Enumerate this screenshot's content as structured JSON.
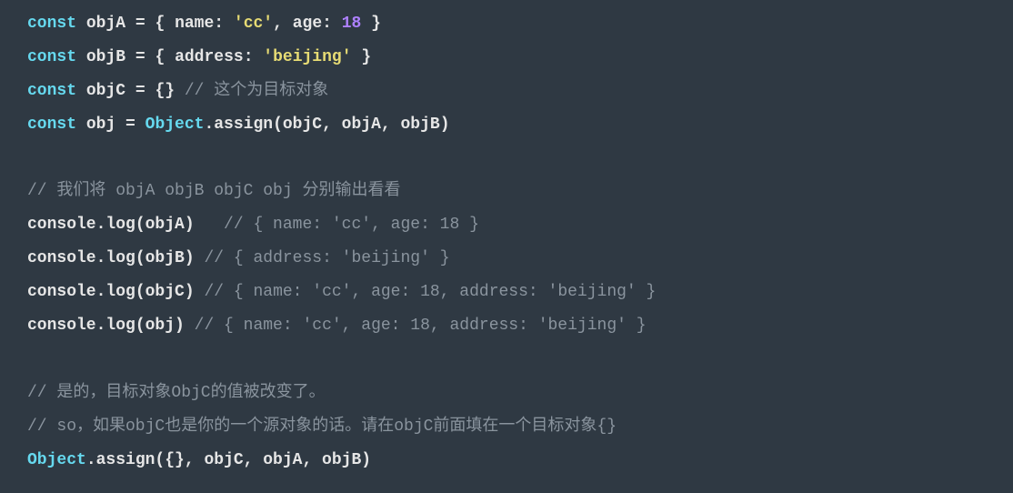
{
  "lines": {
    "l1": {
      "kw": "const",
      "v": "objA",
      "eq": " = { ",
      "p1": "name",
      "s1": "'cc'",
      "c": ", ",
      "p2": "age",
      "n1": "18",
      "end": " }"
    },
    "l2": {
      "kw": "const",
      "v": "objB",
      "eq": " = { ",
      "p1": "address",
      "s1": "'beijing'",
      "end": " }"
    },
    "l3": {
      "kw": "const",
      "v": "objC",
      "eq": " = {} ",
      "cm": "// 这个为目标对象"
    },
    "l4": {
      "kw": "const",
      "v": "obj",
      "eq": " = ",
      "cls": "Object",
      "m": ".assign(",
      "args": "objC, objA, objB)"
    },
    "l6": {
      "cm": "// 我们将 objA objB objC obj 分别输出看看"
    },
    "l7": {
      "call": "console.log(objA)",
      "pad": "   ",
      "cm": "// { name: 'cc', age: 18 }"
    },
    "l8": {
      "call": "console.log(objB)",
      "pad": " ",
      "cm": "// { address: 'beijing' }"
    },
    "l9": {
      "call": "console.log(objC)",
      "pad": " ",
      "cm": "// { name: 'cc', age: 18, address: 'beijing' }"
    },
    "l10": {
      "call": "console.log(obj)",
      "pad": " ",
      "cm": "// { name: 'cc', age: 18, address: 'beijing' }"
    },
    "l12": {
      "cm": "// 是的，目标对象ObjC的值被改变了。"
    },
    "l13": {
      "cm": "// so，如果objC也是你的一个源对象的话。请在objC前面填在一个目标对象{}"
    },
    "l14": {
      "cls": "Object",
      "m": ".assign({}, ",
      "args": "objC, objA, objB)"
    }
  }
}
